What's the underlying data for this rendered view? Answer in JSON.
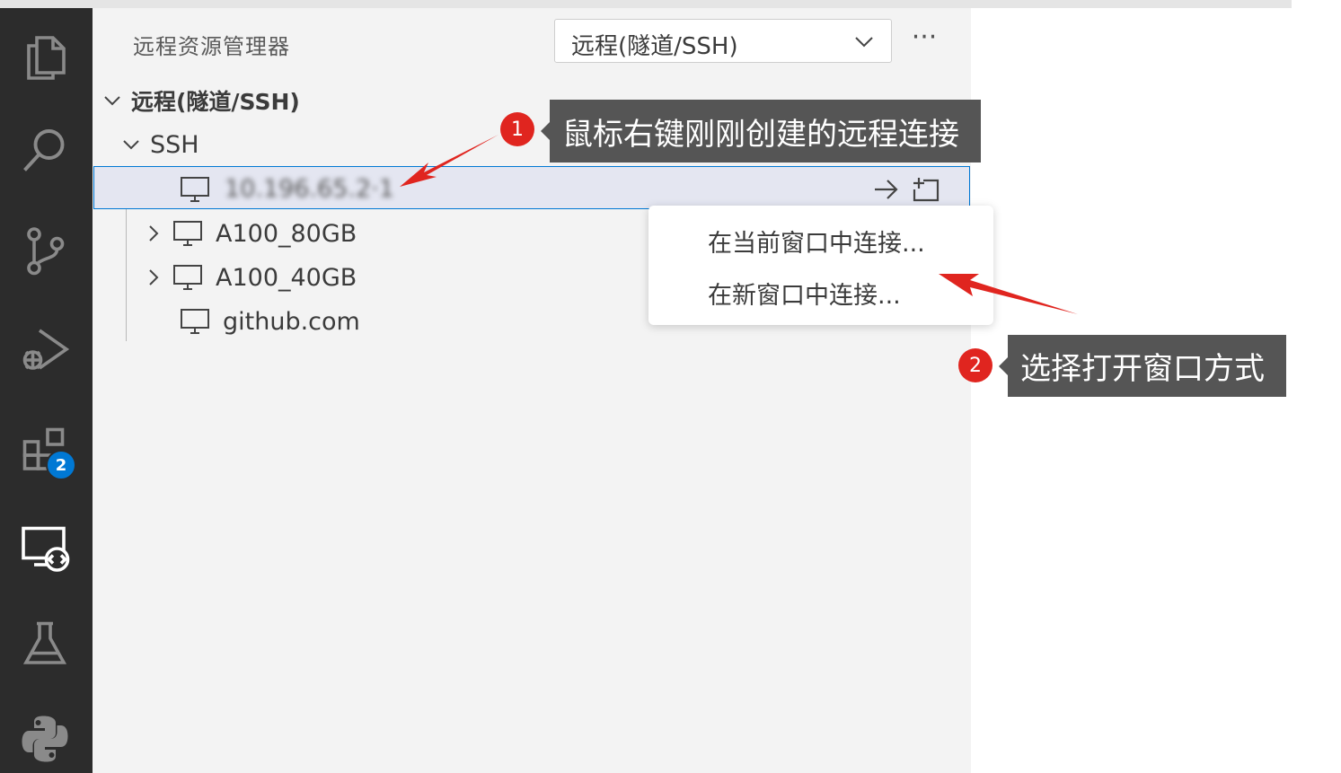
{
  "sidebar": {
    "title": "远程资源管理器",
    "selector_value": "远程(隧道/SSH)",
    "more_label": "···",
    "tree": {
      "root_label": "远程(隧道/SSH)",
      "group_label": "SSH",
      "hosts": [
        {
          "label": "10.196.65.2·1",
          "state": "selected"
        },
        {
          "label": "A100_80GB",
          "state": "collapsed"
        },
        {
          "label": "A100_40GB",
          "state": "collapsed"
        },
        {
          "label": "github.com",
          "state": "leaf"
        }
      ]
    }
  },
  "activity_bar": {
    "items": [
      "explorer-icon",
      "search-icon",
      "source-control-icon",
      "run-debug-icon",
      "extensions-icon",
      "remote-explorer-icon",
      "testing-icon",
      "python-icon"
    ],
    "extensions_badge": "2"
  },
  "context_menu": {
    "items": [
      "在当前窗口中连接...",
      "在新窗口中连接..."
    ]
  },
  "annotations": [
    {
      "number": "1",
      "text": "鼠标右键刚刚创建的远程连接"
    },
    {
      "number": "2",
      "text": "选择打开窗口方式"
    }
  ],
  "colors": {
    "activity_bg": "#2c2c2c",
    "sidebar_bg": "#f3f3f3",
    "selection_border": "#0078d4",
    "annotation_red": "#e0251f",
    "callout_bg": "#555555"
  }
}
